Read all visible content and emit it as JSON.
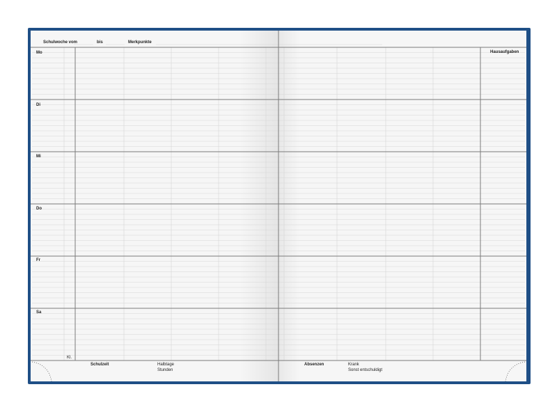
{
  "header": {
    "week_label": "Schulwoche vom",
    "bis_label": "bis",
    "notes_label": "Merkpunkte"
  },
  "homework_label": "Hausaufgaben",
  "days": [
    "Mo",
    "Di",
    "Mi",
    "Do",
    "Fr",
    "Sa"
  ],
  "class_label": "Kl.",
  "footer": {
    "school_time_label": "Schulzeit",
    "half_days_label": "Halbtage",
    "hours_label": "Stunden",
    "absences_label": "Absenzen",
    "sick_label": "Krank",
    "excused_label": "Sonst entschuldigt"
  },
  "colors": {
    "cover": "#1f4f86",
    "paper": "#f6f6f6",
    "heavy_rule": "#7a7a7a",
    "light_rule": "#d6d6d6"
  }
}
